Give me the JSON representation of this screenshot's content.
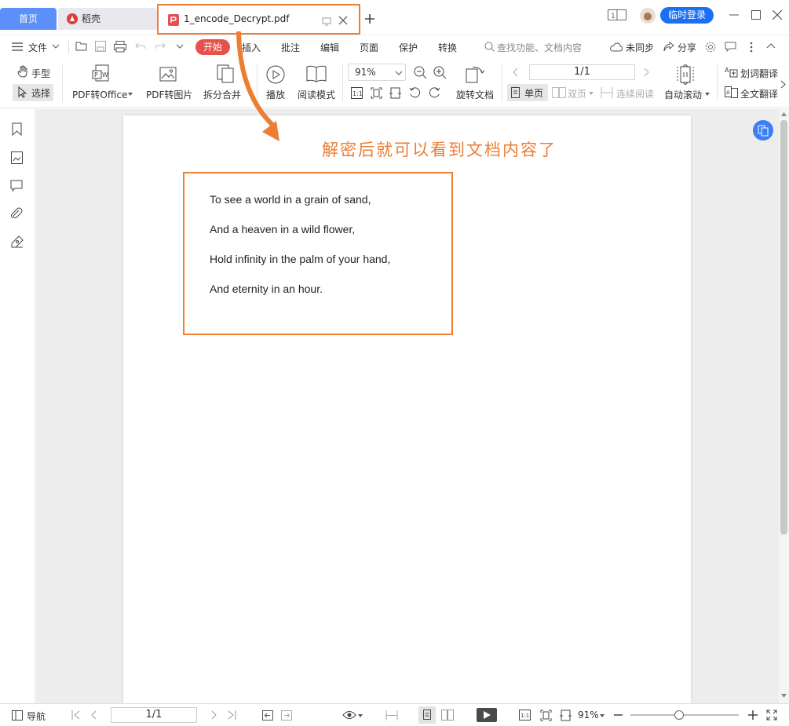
{
  "tabs": {
    "home": "首页",
    "daoke": "稻壳",
    "active_file": "1_encode_Decrypt.pdf"
  },
  "titlebar": {
    "login": "临时登录"
  },
  "menu": {
    "file": "文件",
    "start": "开始",
    "items": [
      "插入",
      "批注",
      "编辑",
      "页面",
      "保护",
      "转换"
    ],
    "search_placeholder": "查找功能、文档内容",
    "unsynced": "未同步",
    "share": "分享"
  },
  "ribbon": {
    "hand": "手型",
    "select": "选择",
    "pdf_to_office": "PDF转Office",
    "pdf_to_image": "PDF转图片",
    "split_merge": "拆分合并",
    "play": "播放",
    "read_mode": "阅读模式",
    "zoom": "91%",
    "rotate_doc": "旋转文档",
    "page_indicator": "1/1",
    "single_page": "单页",
    "double_page": "双页",
    "continuous": "连续阅读",
    "auto_scroll": "自动滚动",
    "word_translate": "划词翻译",
    "full_translate": "全文翻译"
  },
  "document": {
    "annotation": "解密后就可以看到文档内容了",
    "poem": [
      "To see a world in a grain of sand,",
      "And a heaven in a wild flower,",
      "Hold infinity in the palm of your hand,",
      "And eternity in an hour."
    ]
  },
  "statusbar": {
    "nav": "导航",
    "page": "1/1",
    "zoom": "91%"
  },
  "colors": {
    "accent_orange": "#ed7d31",
    "home_tab_blue": "#5b8ff9",
    "start_red": "#e8514b",
    "login_blue": "#1a6ff5"
  }
}
